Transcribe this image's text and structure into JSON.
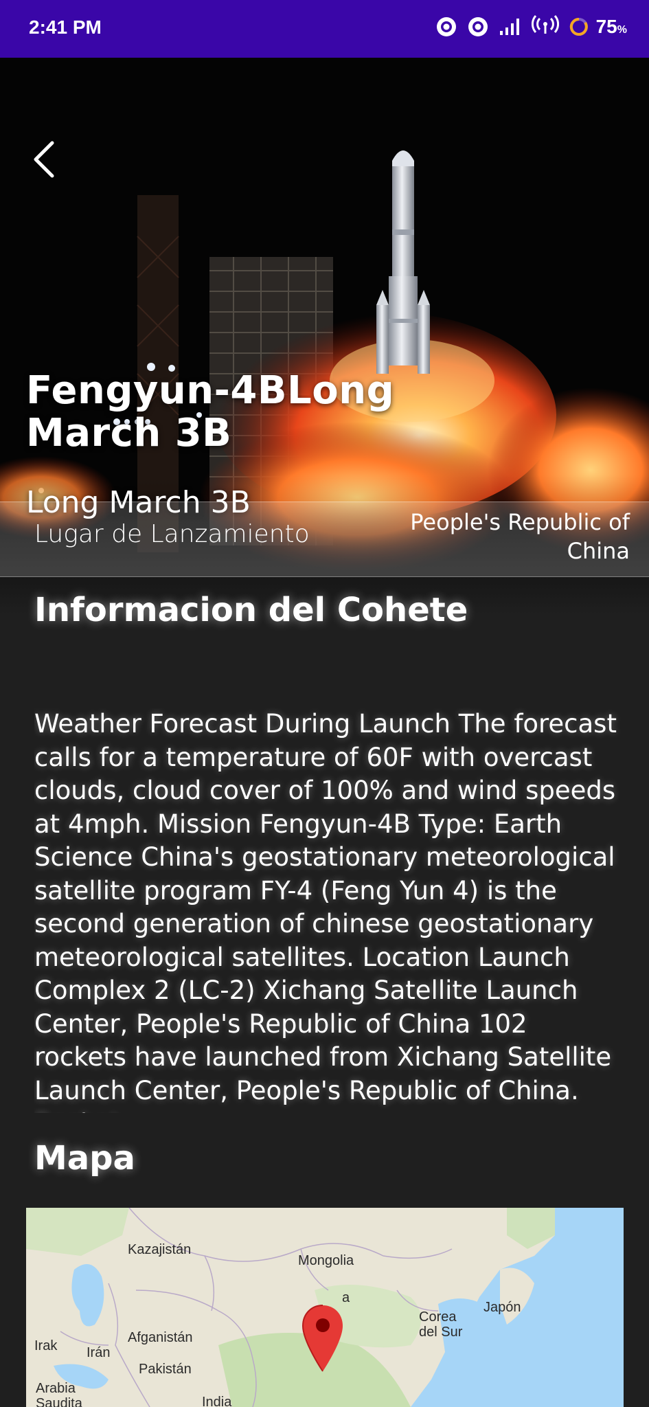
{
  "status_bar": {
    "time": "2:41 PM",
    "battery_value": "75",
    "battery_unit": "%"
  },
  "hero": {
    "title": "Fengyun-4BLong March 3B",
    "subtitle": "Long March 3B"
  },
  "launch_site": {
    "label": "Lugar de Lanzamiento",
    "value": "People's Republic of China"
  },
  "rocket_info": {
    "heading": "Informacion del Cohete",
    "description": "Weather Forecast During Launch The forecast calls for a temperature of 60F with overcast clouds, cloud cover of 100% and wind speeds at 4mph. Mission Fengyun-4B Type: Earth Science China's geostationary meteorological satellite program FY-4 (Feng Yun 4) is the second generation of chinese geostationary meteorological satellites. Location Launch Complex 2 (LC-2) Xichang Satellite Launch Center, People's Republic of China 102 rockets have launched from Xichang Satellite Launch Center, People's Republic of China. Rocket"
  },
  "map_section": {
    "heading": "Mapa",
    "labels": {
      "kazakhstan": "Kazajistán",
      "mongolia": "Mongolia",
      "korea": "Corea del Sur",
      "japan": "Japón",
      "afghanistan": "Afganistán",
      "iraq": "Irak",
      "iran": "Irán",
      "pakistan": "Pakistán",
      "saudi": "Arabia Saudita",
      "india": "India",
      "china_fragment": "a"
    }
  },
  "colors": {
    "status_bar": "#3a06a8",
    "background": "#1f1f1f",
    "pin": "#e53935"
  }
}
